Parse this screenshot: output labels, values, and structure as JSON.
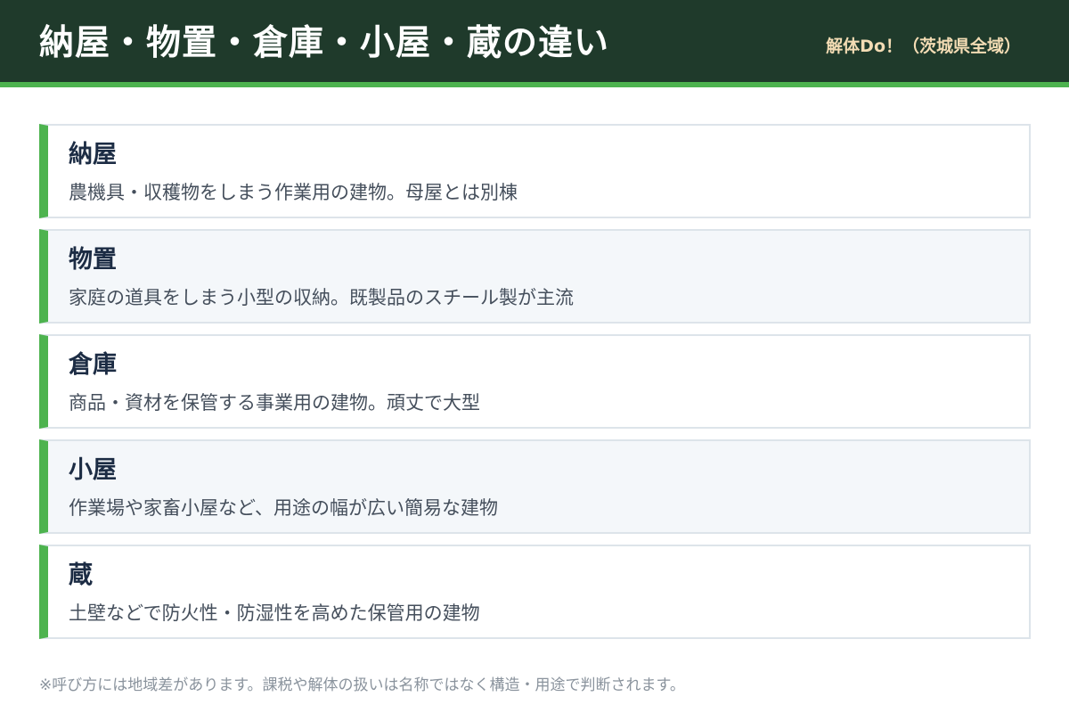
{
  "header": {
    "title": "納屋・物置・倉庫・小屋・蔵の違い",
    "brand": "解体Do！（茨城県全域）"
  },
  "items": [
    {
      "title": "納屋",
      "description": "農機具・収穫物をしまう作業用の建物。母屋とは別棟"
    },
    {
      "title": "物置",
      "description": "家庭の道具をしまう小型の収納。既製品のスチール製が主流"
    },
    {
      "title": "倉庫",
      "description": "商品・資材を保管する事業用の建物。頑丈で大型"
    },
    {
      "title": "小屋",
      "description": "作業場や家畜小屋など、用途の幅が広い簡易な建物"
    },
    {
      "title": "蔵",
      "description": "土壁などで防火性・防湿性を高めた保管用の建物"
    }
  ],
  "footnote": "※呼び方には地域差があります。課税や解体の扱いは名称ではなく構造・用途で判断されます。",
  "colors": {
    "header_background": "#1f3a2b",
    "accent_green": "#4db34f",
    "brand_text": "#f3dcb4"
  }
}
